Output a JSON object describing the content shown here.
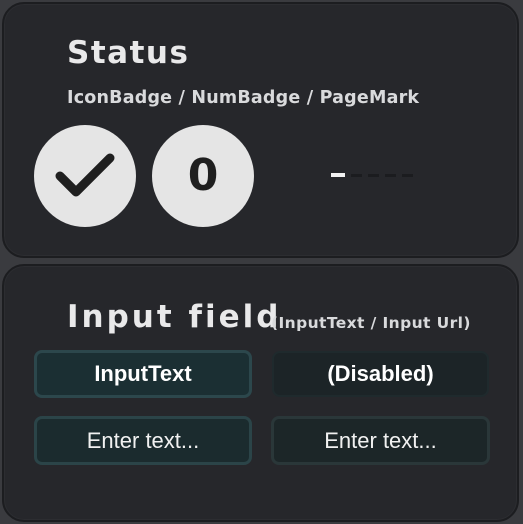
{
  "status": {
    "title": "Status",
    "subtitle": "IconBadge / NumBadge / PageMark",
    "icon_badge": {
      "icon": "check-icon",
      "color": "#e5e5e5"
    },
    "num_badge": {
      "value": "0",
      "color": "#e5e5e5"
    },
    "page_mark": {
      "total": 5,
      "active_index": 0,
      "active_color": "#f2f2f2",
      "inactive_color": "#1b1c1f"
    }
  },
  "input": {
    "title": "Input field",
    "subtitle": "(InputText / Input Url)",
    "input_text_label": "InputText",
    "disabled_label": "(Disabled)",
    "field1_placeholder": "Enter text...",
    "field2_placeholder": "Enter text..."
  },
  "colors": {
    "background": "#3a3b3f",
    "panel": "#26272b",
    "accent_border": "#2c474c"
  }
}
